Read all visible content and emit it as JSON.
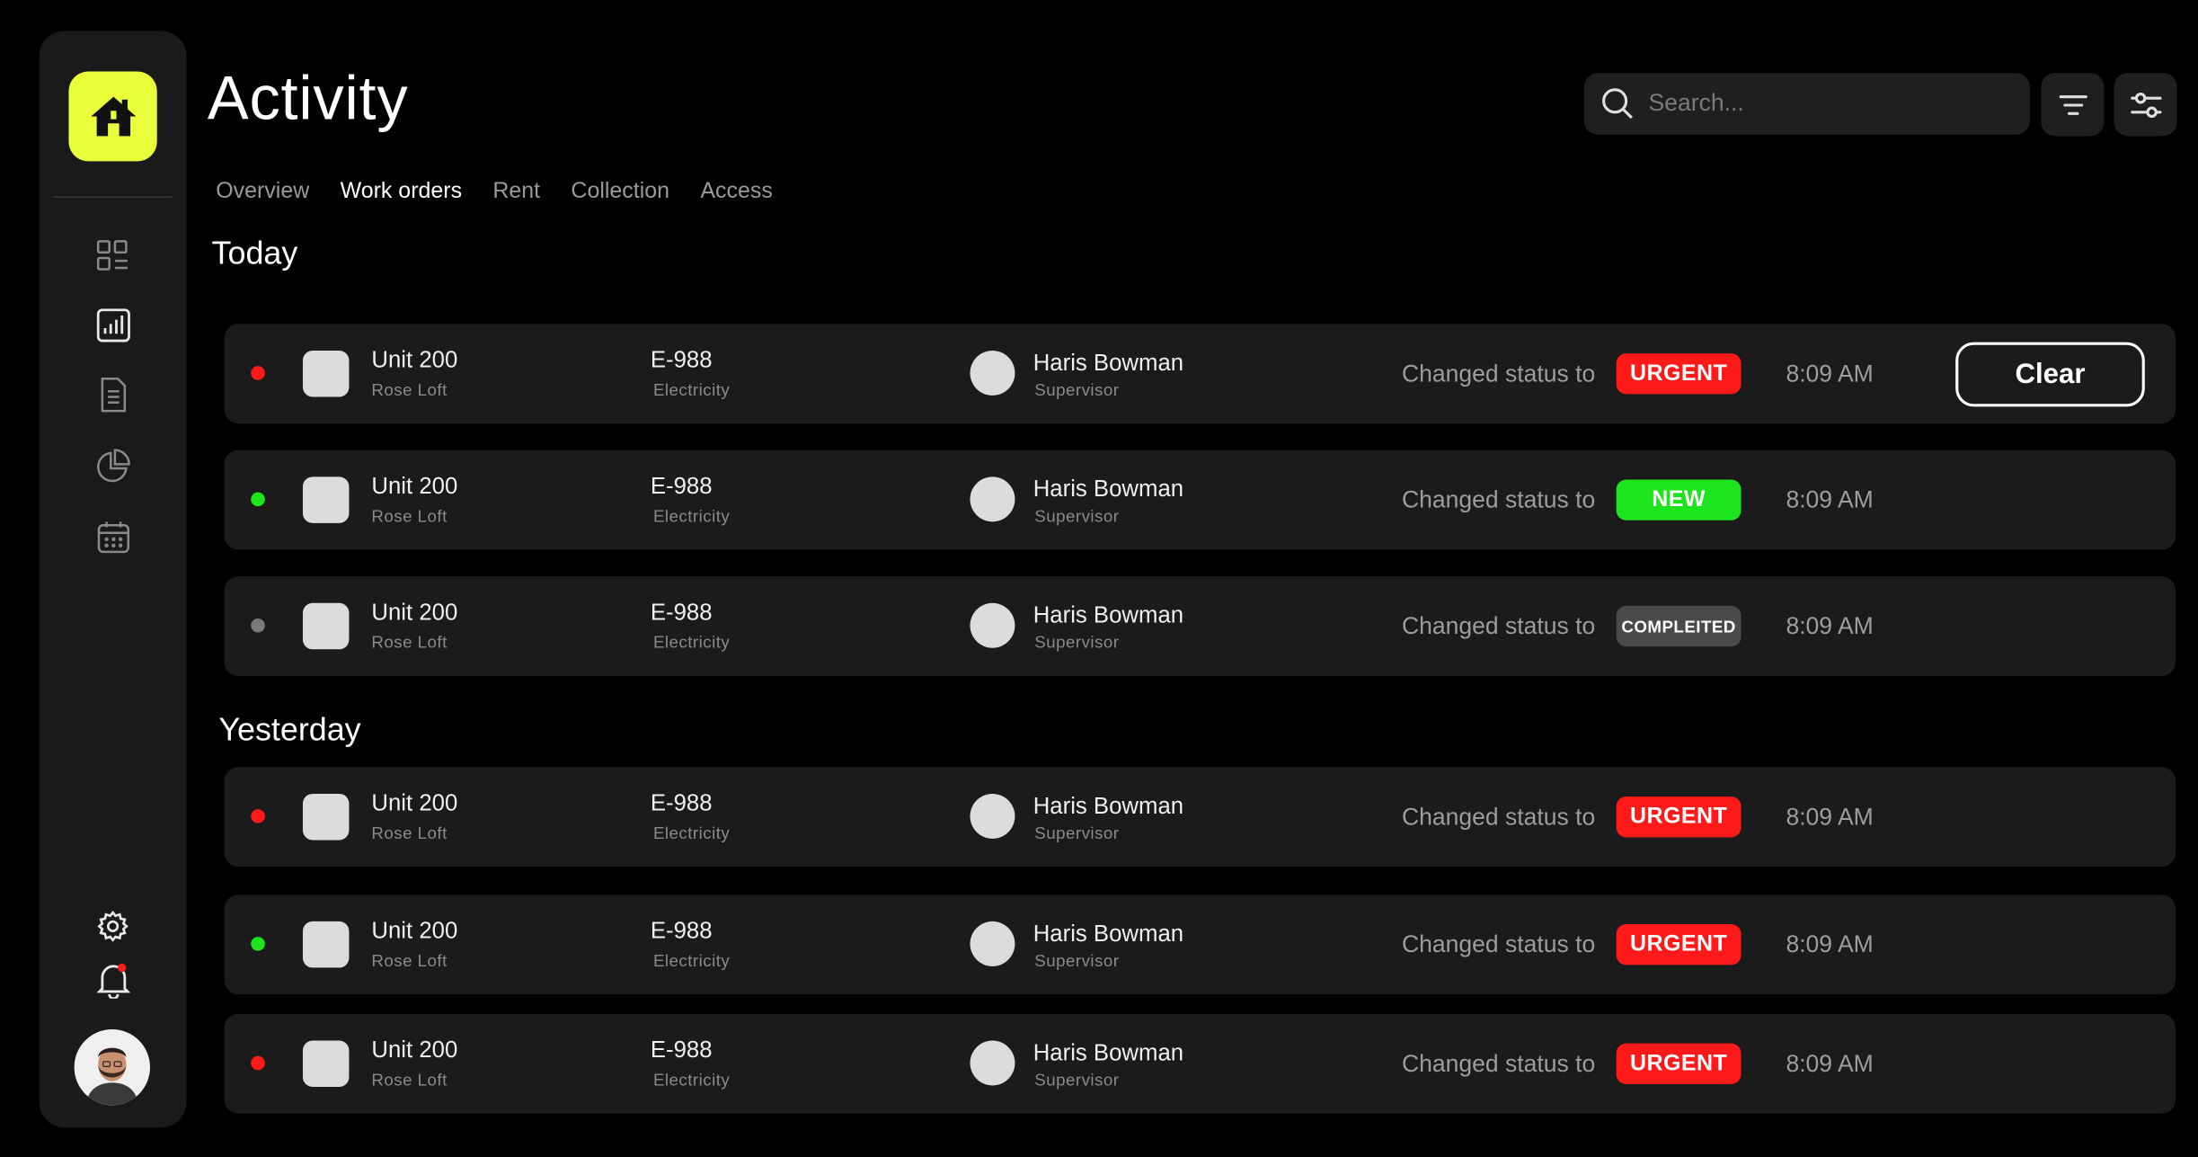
{
  "header": {
    "title": "Activity",
    "search_placeholder": "Search..."
  },
  "tabs": [
    {
      "label": "Overview",
      "active": false
    },
    {
      "label": "Work orders",
      "active": true
    },
    {
      "label": "Rent",
      "active": false
    },
    {
      "label": "Collection",
      "active": false
    },
    {
      "label": "Access",
      "active": false
    }
  ],
  "sidebar": {
    "icons": [
      "dashboard-icon",
      "bar-chart-icon",
      "document-icon",
      "pie-chart-icon",
      "calendar-icon"
    ],
    "bottom_icons": [
      "settings-icon",
      "notification-bell-icon"
    ]
  },
  "colors": {
    "accent": "#e9ff3c",
    "urgent": "#ff1a1a",
    "new": "#1de51d",
    "completed": "#4a4a4a",
    "dot_red": "#ff1a1a",
    "dot_green": "#1de51d",
    "dot_gray": "#7a7a7a"
  },
  "sections": [
    {
      "title": "Today",
      "rows": [
        {
          "unit": "Unit 200",
          "property": "Rose Loft",
          "code": "E-988",
          "category": "Electricity",
          "person": "Haris Bowman",
          "role": "Supervisor",
          "changed_label": "Changed status to",
          "status": "URGENT",
          "status_type": "urgent",
          "dot": "red",
          "time": "8:09 AM",
          "action": "Clear"
        },
        {
          "unit": "Unit 200",
          "property": "Rose Loft",
          "code": "E-988",
          "category": "Electricity",
          "person": "Haris Bowman",
          "role": "Supervisor",
          "changed_label": "Changed status to",
          "status": "NEW",
          "status_type": "new",
          "dot": "green",
          "time": "8:09 AM"
        },
        {
          "unit": "Unit 200",
          "property": "Rose Loft",
          "code": "E-988",
          "category": "Electricity",
          "person": "Haris Bowman",
          "role": "Supervisor",
          "changed_label": "Changed status to",
          "status": "COMPLEITED",
          "status_type": "completed",
          "dot": "gray",
          "time": "8:09 AM"
        }
      ]
    },
    {
      "title": "Yesterday",
      "rows": [
        {
          "unit": "Unit 200",
          "property": "Rose Loft",
          "code": "E-988",
          "category": "Electricity",
          "person": "Haris Bowman",
          "role": "Supervisor",
          "changed_label": "Changed status to",
          "status": "URGENT",
          "status_type": "urgent",
          "dot": "red",
          "time": "8:09 AM"
        },
        {
          "unit": "Unit 200",
          "property": "Rose Loft",
          "code": "E-988",
          "category": "Electricity",
          "person": "Haris Bowman",
          "role": "Supervisor",
          "changed_label": "Changed status to",
          "status": "URGENT",
          "status_type": "urgent",
          "dot": "green",
          "time": "8:09 AM"
        },
        {
          "unit": "Unit 200",
          "property": "Rose Loft",
          "code": "E-988",
          "category": "Electricity",
          "person": "Haris Bowman",
          "role": "Supervisor",
          "changed_label": "Changed status to",
          "status": "URGENT",
          "status_type": "urgent",
          "dot": "red",
          "time": "8:09 AM"
        }
      ]
    }
  ]
}
